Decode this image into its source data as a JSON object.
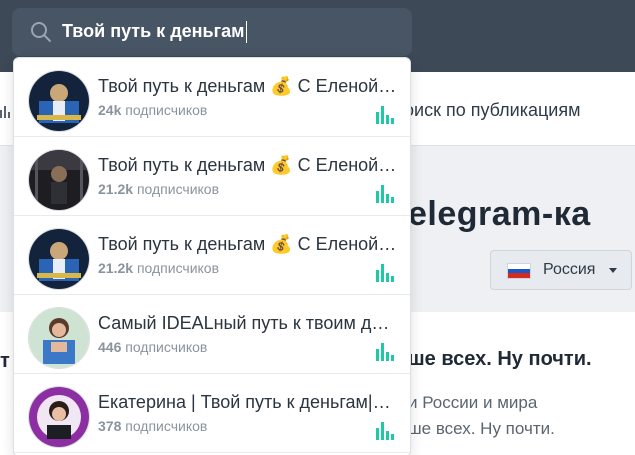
{
  "search": {
    "query": "Твой путь к деньгам"
  },
  "subnav": {
    "link_label": "оиск по публикациям"
  },
  "page": {
    "heading": "elegram-ка",
    "country": {
      "label": "Россия"
    },
    "card": {
      "left_fragment": "т",
      "title": "ше всех. Ну почти.",
      "line1": "и России и мира",
      "line2": "ше всех. Ну почти."
    }
  },
  "results": [
    {
      "title": "Твой путь к деньгам 💰 С Еленой…",
      "count": "24k",
      "label": "подписчиков",
      "avatar": "dark-blue"
    },
    {
      "title": "Твой путь к деньгам 💰 С Еленой…",
      "count": "21.2k",
      "label": "подписчиков",
      "avatar": "dark-gray"
    },
    {
      "title": "Твой путь к деньгам 💰 С Еленой…",
      "count": "21.2k",
      "label": "подписчиков",
      "avatar": "dark-blue"
    },
    {
      "title": "Самый IDEALный путь к твоим д…",
      "count": "446",
      "label": "подписчиков",
      "avatar": "light-blue"
    },
    {
      "title": "Екатерина | Твой путь к деньгам|…",
      "count": "378",
      "label": "подписчиков",
      "avatar": "purple"
    }
  ],
  "colors": {
    "topbar": "#3d4957",
    "search_bg": "#485564",
    "accent_teal": "#20c9a6"
  },
  "icons": {
    "search": "search-icon",
    "stats": "bar-chart-icon",
    "flag": "russia-flag-icon",
    "caret": "caret-down-icon"
  }
}
